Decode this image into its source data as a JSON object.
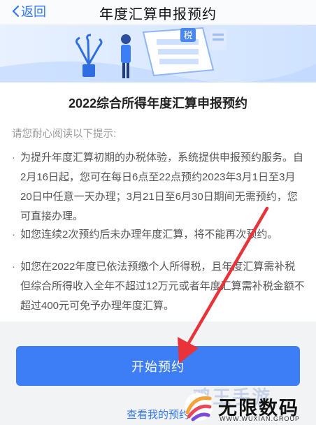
{
  "nav": {
    "back_label": "返回",
    "title": "年度汇算申报预约"
  },
  "banner": {
    "badge_text": "税"
  },
  "card": {
    "title": "2022综合所得年度汇算申报预约",
    "hint": "请您耐心阅读以下提示:",
    "items": [
      {
        "text": "为提升年度汇算初期的办税体验，系统提供申报预约服务。自2月16日起，您可在每日6点至22点预约2023年3月1日至3月20日中任意一天办理；3月21日至6月30日期间无需预约，您可直接办理。"
      },
      {
        "text": "如您连续2次预约后未办理年度汇算，将不能再次预约。"
      },
      {
        "text": "如您在2022年度已依法预缴个人所得税，且年度汇算需补税但综合所得收入全年不超过12万元或者年度汇算需补税金额不超过400元可免予办理年度汇算。"
      }
    ]
  },
  "actions": {
    "start_label": "开始预约",
    "view_label": "查看我的预约"
  },
  "watermark": {
    "ghost_text": "鸡王手游",
    "name": "无限数码",
    "url": "WWW.WUXIAN.GROUP"
  },
  "colors": {
    "primary": "#3d7df5",
    "link": "#3478f6",
    "annotation_arrow": "#e8333a"
  }
}
